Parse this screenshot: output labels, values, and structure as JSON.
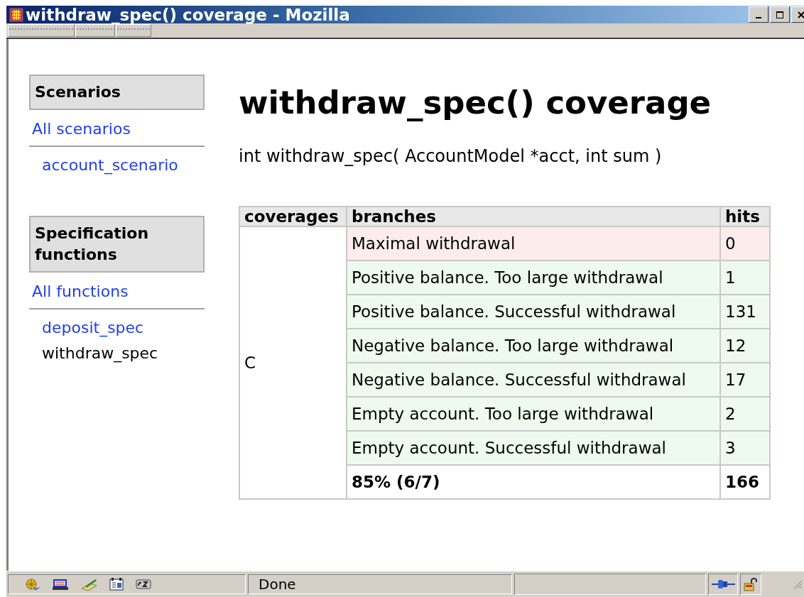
{
  "window": {
    "title": "withdraw_spec() coverage - Mozilla"
  },
  "sidebar": {
    "sections": [
      {
        "title": "Scenarios",
        "all_link": "All scenarios",
        "items": [
          {
            "label": "account_scenario",
            "selected": false
          }
        ]
      },
      {
        "title": "Specification functions",
        "all_link": "All functions",
        "items": [
          {
            "label": "deposit_spec",
            "selected": false
          },
          {
            "label": "withdraw_spec",
            "selected": true
          }
        ]
      }
    ]
  },
  "heading": "withdraw_spec() coverage",
  "signature": "int withdraw_spec( AccountModel *acct, int sum )",
  "table": {
    "columns": [
      "coverages",
      "branches",
      "hits"
    ],
    "coverage": "C",
    "rows": [
      {
        "branch": "Maximal withdrawal",
        "hits": "0",
        "covered": false
      },
      {
        "branch": "Positive balance. Too large withdrawal",
        "hits": "1",
        "covered": true
      },
      {
        "branch": "Positive balance. Successful withdrawal",
        "hits": "131",
        "covered": true
      },
      {
        "branch": "Negative balance. Too large withdrawal",
        "hits": "12",
        "covered": true
      },
      {
        "branch": "Negative balance. Successful withdrawal",
        "hits": "17",
        "covered": true
      },
      {
        "branch": "Empty account. Too large withdrawal",
        "hits": "2",
        "covered": true
      },
      {
        "branch": "Empty account. Successful withdrawal",
        "hits": "3",
        "covered": true
      }
    ],
    "total": {
      "percent": "85% (6/7)",
      "hits": "166"
    }
  },
  "status_bar": {
    "text": "Done"
  }
}
